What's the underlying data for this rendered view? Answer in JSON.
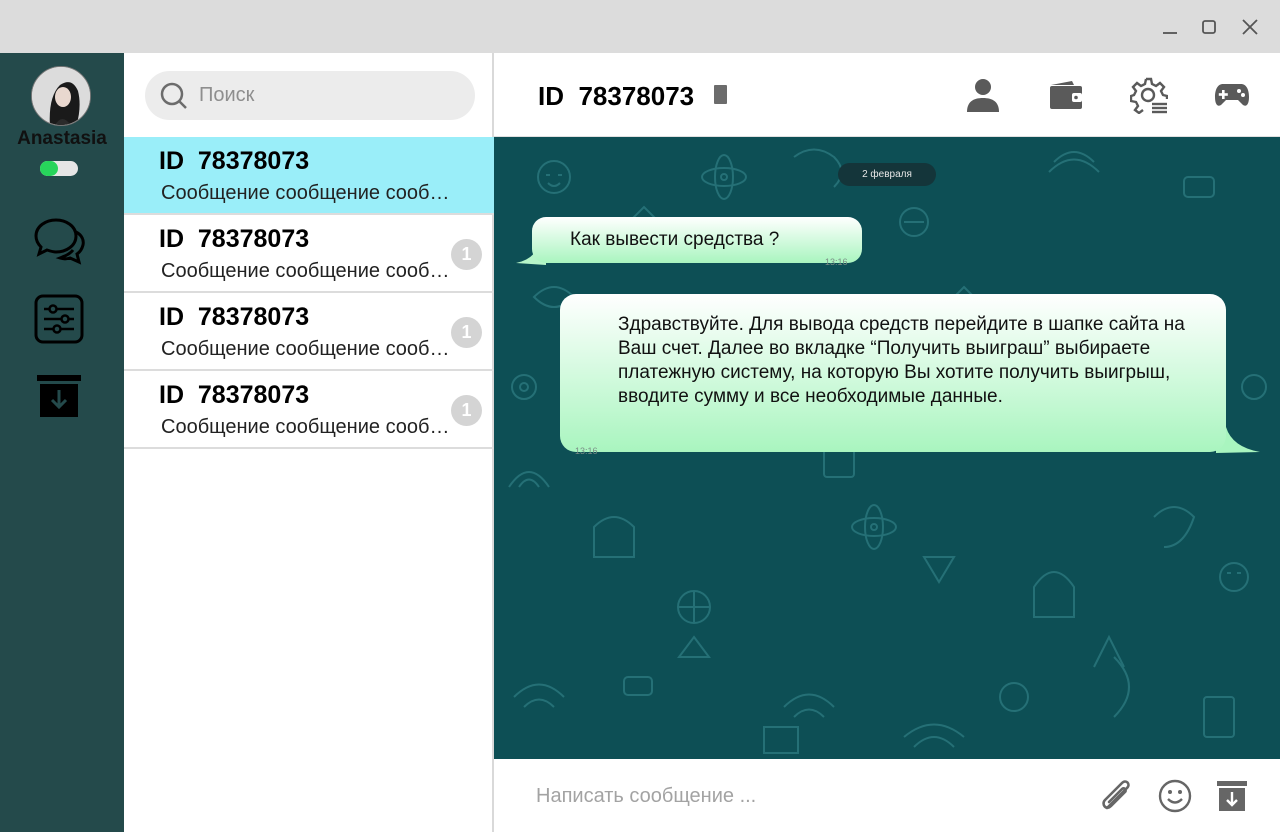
{
  "window": {
    "controls": [
      "minimize-icon",
      "maximize-icon",
      "close-icon"
    ]
  },
  "user": {
    "name": "Anastasia",
    "online": true
  },
  "rail": {
    "items": [
      "chats-icon",
      "settings-sliders-icon",
      "archive-icon"
    ]
  },
  "search": {
    "placeholder": "Поиск"
  },
  "chats": [
    {
      "id": "ID  78378073",
      "preview": "Сообщение сообщение сообщение",
      "unread": "",
      "active": true
    },
    {
      "id": "ID  78378073",
      "preview": "Сообщение сообщение сообщение",
      "unread": "1",
      "active": false
    },
    {
      "id": "ID  78378073",
      "preview": "Сообщение сообщение сообщение",
      "unread": "1",
      "active": false
    },
    {
      "id": "ID  78378073",
      "preview": "Сообщение сообщение сообщение",
      "unread": "1",
      "active": false
    }
  ],
  "header": {
    "title": "ID  78378073",
    "icons": [
      "user-icon",
      "wallet-icon",
      "settings-gear-icon",
      "gamepad-icon"
    ]
  },
  "conversation": {
    "date": "2 февраля",
    "messages": [
      {
        "side": "incoming",
        "text": "Как вывести средства ?",
        "time": "13:16"
      },
      {
        "side": "outgoing",
        "text": "Здравствуйте. Для вывода средств перейдите в шапке сайта на Ваш счет. Далее во вкладке “Получить выиграш” выбираете платежную систему, на которую Вы хотите получить выигрыш, вводите сумму и все необходимые данные.",
        "time": "13:16"
      }
    ]
  },
  "composer": {
    "placeholder": "Написать сообщение ...",
    "icons": [
      "paperclip-icon",
      "emoji-icon",
      "archive-download-icon"
    ]
  },
  "colors": {
    "rail": "#244a4b",
    "chat_bg": "#0d4f55",
    "active_item": "#9aeef9",
    "online": "#27d45b",
    "bubble_gradient": [
      "#ffffff",
      "#a9f5bf"
    ]
  }
}
